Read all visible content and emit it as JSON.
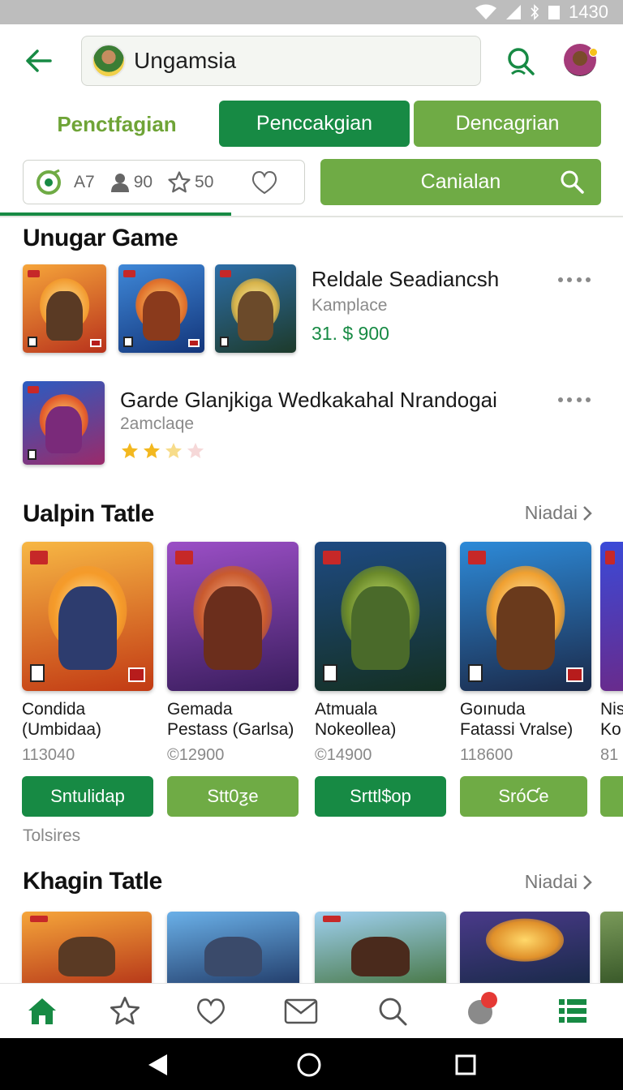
{
  "status_bar": {
    "time": "1430"
  },
  "header": {
    "title": "Ungamsia"
  },
  "tabs": [
    {
      "label": "Penctfagian"
    },
    {
      "label": "Penccakgian"
    },
    {
      "label": "Dencagrian"
    }
  ],
  "stats": {
    "level": "A7",
    "users": "90",
    "stars": "50"
  },
  "cta": {
    "label": "Canialan"
  },
  "section1": {
    "title": "Unugar Game",
    "items": [
      {
        "title": "Reldale Seadiancsh",
        "subtitle": "Kamplace",
        "price": "31. $ 900"
      },
      {
        "title": "Garde Glanjkiga Wedkakahal Nrandogai",
        "subtitle": "2amclaqe",
        "rating": 2
      }
    ]
  },
  "section2": {
    "title": "Ualpin Tatle",
    "see_all": "Niadai",
    "cards": [
      {
        "title_line1": "Condida",
        "title_line2": "(Umbidaa)",
        "price": "113040",
        "button": "Sntulidap"
      },
      {
        "title_line1": "Gemada",
        "title_line2": "Pestass (Garlsa)",
        "price": "©12900",
        "button": "Stt0ƺe"
      },
      {
        "title_line1": "Atmuala",
        "title_line2": "Nokeollea)",
        "price": "©14900",
        "button": "Srttl$op"
      },
      {
        "title_line1": "Goınuda",
        "title_line2": "Fatassi Vralse)",
        "price": "118600",
        "button": "SróƇe"
      },
      {
        "title_line1": "Nis",
        "title_line2": "Ko",
        "price": "81",
        "button": ""
      }
    ],
    "footnote": "Tolsires"
  },
  "section3": {
    "title": "Khagin Tatle",
    "see_all": "Niadai"
  },
  "colors": {
    "primary": "#178a44",
    "secondary": "#6fab45",
    "accent_text": "#6fa437"
  },
  "icons": {
    "bottom_nav": [
      "home-icon",
      "star-icon",
      "heart-icon",
      "mail-icon",
      "search-icon",
      "profile-icon",
      "list-icon"
    ]
  }
}
